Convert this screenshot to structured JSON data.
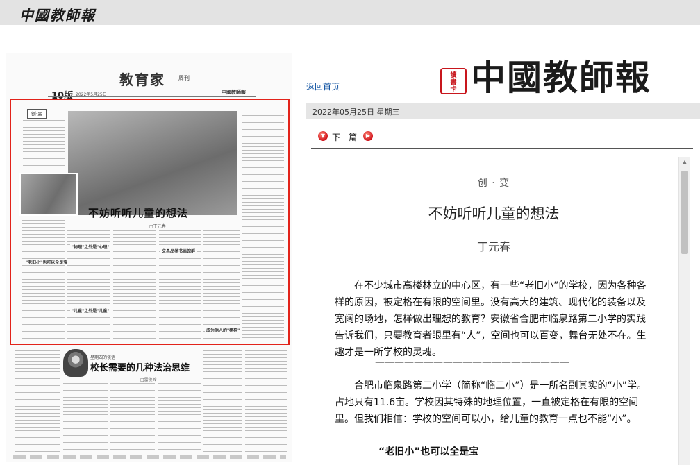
{
  "header": {
    "brand": "中國教師報"
  },
  "paper_page": {
    "page_num": "10版",
    "page_info": "2022年5月25日",
    "column": "教育家",
    "column_sub": "周刊",
    "minibrand": "中國教師報",
    "tag": "创·变",
    "story_title": "不妨听听儿童的想法",
    "story_author": "□丁元春",
    "subheads": [
      "\"老旧小\"也可以全是宝",
      "\"物理\"之外是\"心理\"",
      "\"儿童\"之外是\"儿童\"",
      "文具品类书画馆群",
      "成为他人的\"榜样\""
    ],
    "weekly_name": "星期四的谈话",
    "story2_title": "校长需要的几种法治思维",
    "story2_author": "□雷俊岭"
  },
  "logo": {
    "seal": [
      "讀",
      "書",
      "卡"
    ],
    "text": "中國教師報"
  },
  "nav": {
    "back_home": "返回首页",
    "date": "2022年05月25日  星期三",
    "next": "下一篇"
  },
  "article": {
    "kicker": "创 · 变",
    "title": "不妨听听儿童的想法",
    "author": "丁元春",
    "para1": "在不少城市高楼林立的中心区，有一些“老旧小”的学校，因为各种各样的原因，被定格在有限的空间里。没有高大的建筑、现代化的装备以及宽阔的场地，怎样做出理想的教育？安徽省合肥市临泉路第二小学的实践告诉我们，只要教育者眼里有“人”，空间也可以百变，舞台无处不在。生趣才是一所学校的灵魂。",
    "divider": "————————————————————",
    "para2": "合肥市临泉路第二小学（简称“临二小”）是一所名副其实的“小”学。占地只有11.6亩。学校因其特殊的地理位置，一直被定格在有限的空间里。但我们相信：学校的空间可以小，给儿童的教育一点也不能“小”。",
    "section1": "“老旧小”也可以全是宝"
  }
}
